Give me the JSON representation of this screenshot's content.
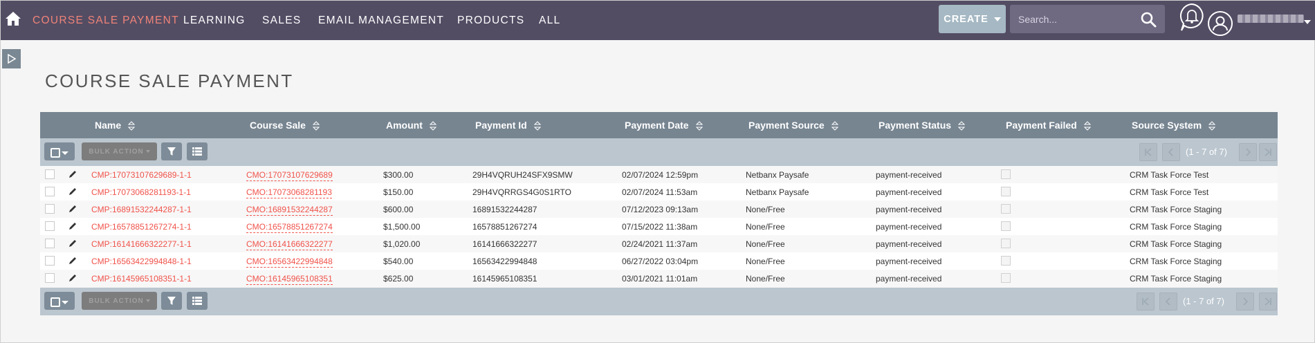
{
  "nav": {
    "items": [
      "COURSE SALE PAYMENT",
      "LEARNING",
      "SALES",
      "EMAIL MANAGEMENT",
      "PRODUCTS",
      "ALL"
    ],
    "create_label": "CREATE",
    "search_placeholder": "Search..."
  },
  "page": {
    "title": "COURSE SALE PAYMENT"
  },
  "table": {
    "columns": [
      "Name",
      "Course Sale",
      "Amount",
      "Payment Id",
      "Payment Date",
      "Payment Source",
      "Payment Status",
      "Payment Failed",
      "Source System"
    ],
    "bulk_action_label": "BULK ACTION",
    "pagination": "(1 - 7 of 7)",
    "rows": [
      {
        "name": "CMP:17073107629689-1-1",
        "course_sale": "CMO:17073107629689",
        "amount": "$300.00",
        "payment_id": "29H4VQRUH24SFX9SMW",
        "payment_date": "02/07/2024 12:59pm",
        "payment_source": "Netbanx Paysafe",
        "payment_status": "payment-received",
        "source_system": "CRM Task Force Test"
      },
      {
        "name": "CMP:17073068281193-1-1",
        "course_sale": "CMO:17073068281193",
        "amount": "$150.00",
        "payment_id": "29H4VQRRGS4G0S1RTO",
        "payment_date": "02/07/2024 11:53am",
        "payment_source": "Netbanx Paysafe",
        "payment_status": "payment-received",
        "source_system": "CRM Task Force Test"
      },
      {
        "name": "CMP:16891532244287-1-1",
        "course_sale": "CMO:16891532244287",
        "amount": "$600.00",
        "payment_id": "16891532244287",
        "payment_date": "07/12/2023 09:13am",
        "payment_source": "None/Free",
        "payment_status": "payment-received",
        "source_system": "CRM Task Force Staging"
      },
      {
        "name": "CMP:16578851267274-1-1",
        "course_sale": "CMO:16578851267274",
        "amount": "$1,500.00",
        "payment_id": "16578851267274",
        "payment_date": "07/15/2022 11:38am",
        "payment_source": "None/Free",
        "payment_status": "payment-received",
        "source_system": "CRM Task Force Staging"
      },
      {
        "name": "CMP:16141666322277-1-1",
        "course_sale": "CMO:16141666322277",
        "amount": "$1,020.00",
        "payment_id": "16141666322277",
        "payment_date": "02/24/2021 11:37am",
        "payment_source": "None/Free",
        "payment_status": "payment-received",
        "source_system": "CRM Task Force Staging"
      },
      {
        "name": "CMP:16563422994848-1-1",
        "course_sale": "CMO:16563422994848",
        "amount": "$540.00",
        "payment_id": "16563422994848",
        "payment_date": "06/27/2022 03:04pm",
        "payment_source": "None/Free",
        "payment_status": "payment-received",
        "source_system": "CRM Task Force Staging"
      },
      {
        "name": "CMP:16145965108351-1-1",
        "course_sale": "CMO:16145965108351",
        "amount": "$625.00",
        "payment_id": "16145965108351",
        "payment_date": "03/01/2021 11:01am",
        "payment_source": "None/Free",
        "payment_status": "payment-received",
        "source_system": "CRM Task Force Staging"
      }
    ]
  },
  "icons": [
    "home-icon",
    "search-icon",
    "bell-icon",
    "user-icon",
    "sidebar-toggle-icon",
    "sort-icon",
    "select-all-icon",
    "filter-icon",
    "column-chooser-icon",
    "pencil-icon",
    "first-page-icon",
    "prev-page-icon",
    "next-page-icon",
    "last-page-icon"
  ],
  "colors": {
    "nav_bg": "#534d64",
    "active_nav": "#f08377",
    "link": "#f0524a",
    "table_header": "#778591",
    "toolbar": "#bbc6cf"
  }
}
